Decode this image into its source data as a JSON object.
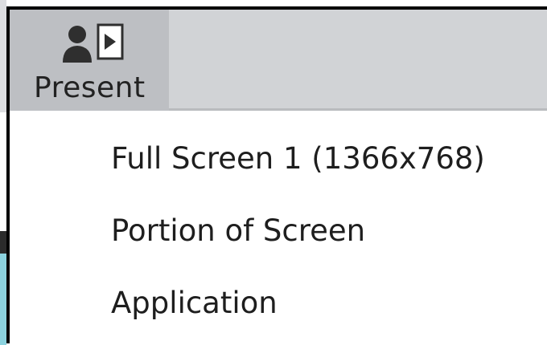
{
  "toolbar": {
    "present_label": "Present"
  },
  "icons": {
    "present": "present-person-screen-icon"
  },
  "colors": {
    "toolbar_bg": "#d1d3d6",
    "button_active_bg": "#bdbfc3",
    "menu_bg": "#ffffff",
    "border": "#000000"
  },
  "menu": {
    "items": [
      {
        "label": "Full Screen 1 (1366x768)"
      },
      {
        "label": "Portion of Screen"
      },
      {
        "label": "Application"
      }
    ]
  }
}
